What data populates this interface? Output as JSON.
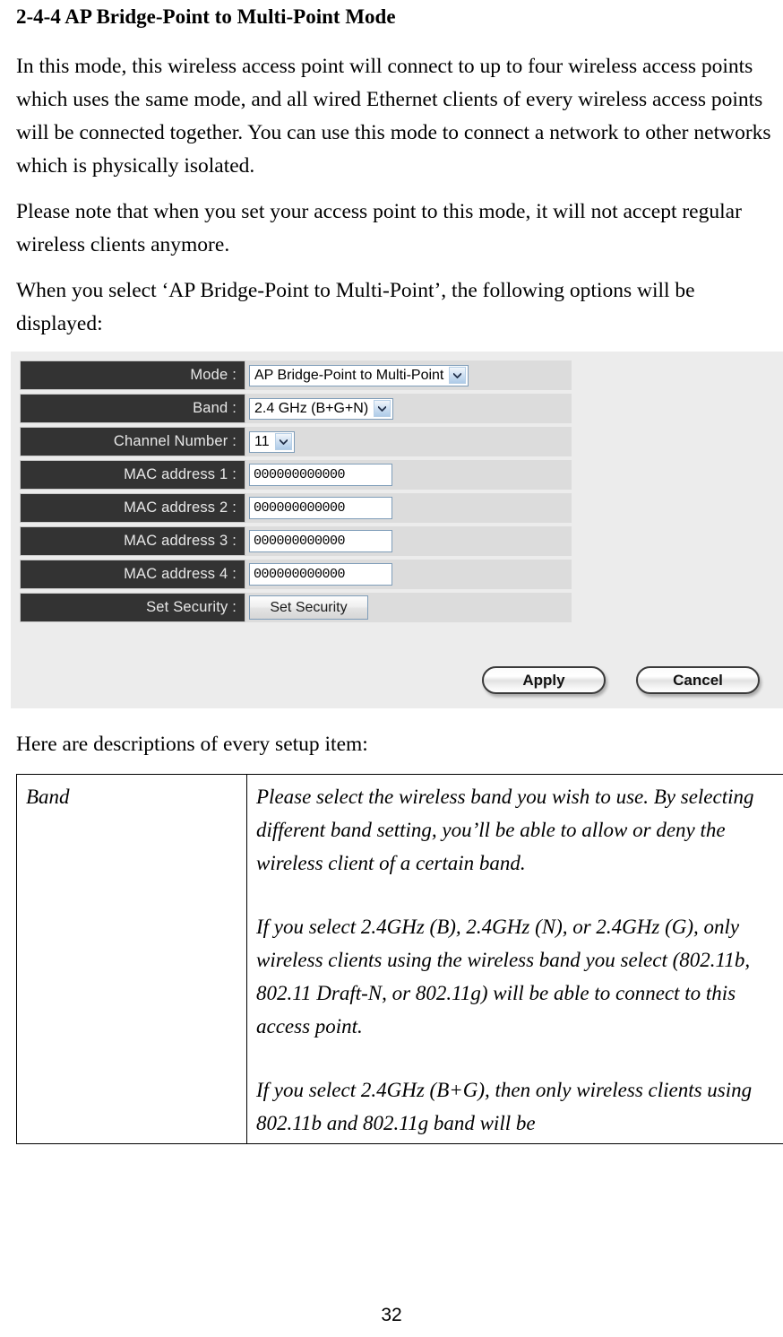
{
  "document": {
    "heading": "2-4-4 AP Bridge-Point to Multi-Point Mode",
    "paragraphs": [
      "In this mode, this wireless access point will connect to up to four wireless access points which uses the same mode, and all wired Ethernet clients of every wireless access points will be connected together. You can use this mode to connect a network to other networks which is physically isolated.",
      "Please note that when you set your access point to this mode, it will not accept regular wireless clients anymore.",
      "When you select ‘AP Bridge-Point to Multi-Point’, the following options will be displayed:"
    ],
    "after_figure_text": "Here are descriptions of every setup item:",
    "page_number": "32"
  },
  "router_ui": {
    "rows": [
      {
        "label": "Mode :",
        "control": "select",
        "value": "AP Bridge-Point to Multi-Point"
      },
      {
        "label": "Band :",
        "control": "select",
        "value": "2.4 GHz (B+G+N)"
      },
      {
        "label": "Channel Number :",
        "control": "select",
        "value": "11"
      },
      {
        "label": "MAC address 1 :",
        "control": "input",
        "value": "000000000000"
      },
      {
        "label": "MAC address 2 :",
        "control": "input",
        "value": "000000000000"
      },
      {
        "label": "MAC address 3 :",
        "control": "input",
        "value": "000000000000"
      },
      {
        "label": "MAC address 4 :",
        "control": "input",
        "value": "000000000000"
      },
      {
        "label": "Set Security :",
        "control": "button",
        "value": "Set Security"
      }
    ],
    "apply_label": "Apply",
    "cancel_label": "Cancel",
    "colors": {
      "panel_background": "#ececec",
      "label_background": "#333333",
      "label_text": "#e8e8e8",
      "value_background": "#dcdcdc",
      "input_border": "#7f9db9"
    }
  },
  "description_table": {
    "rows": [
      {
        "term": "Band",
        "paragraphs": [
          "Please select the wireless band you wish to use. By selecting different band setting, you’ll be able to allow or deny the wireless client of a certain band.",
          "If you select 2.4GHz (B), 2.4GHz (N), or 2.4GHz (G), only wireless clients using the wireless band you select (802.11b, 802.11 Draft-N, or 802.11g) will be able to connect to this access point.",
          "If you select 2.4GHz (B+G), then only wireless clients using 802.11b and 802.11g band will be"
        ]
      }
    ]
  }
}
